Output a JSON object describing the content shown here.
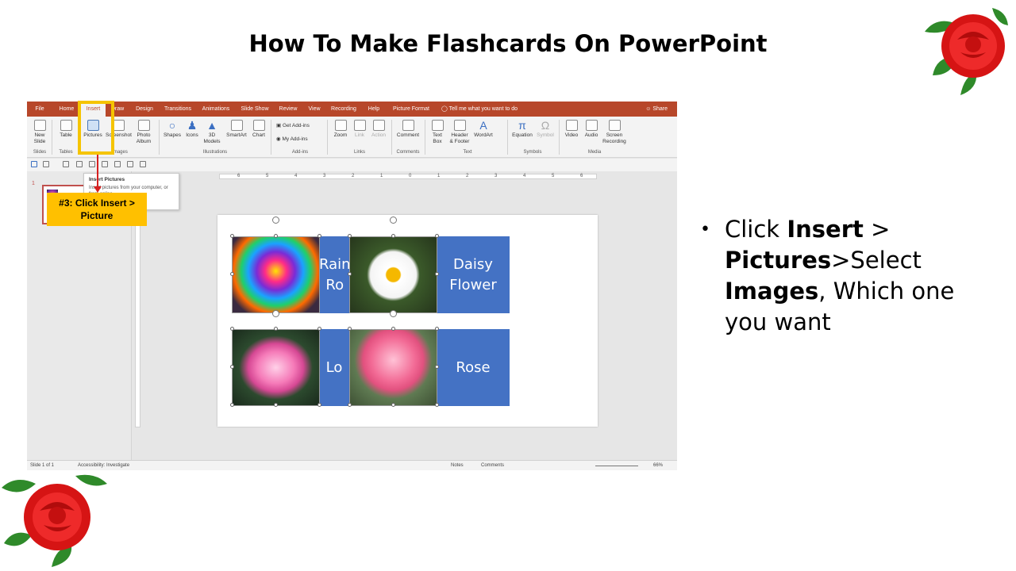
{
  "slide": {
    "title": "How To Make Flashcards On PowerPoint",
    "bullet": {
      "part1": "Click ",
      "bold1": "Insert",
      "part2": "  > ",
      "bold2": "Pictures",
      "part3": ">Select ",
      "bold3": "Images",
      "part4": ", Which one you want"
    },
    "callout": "#3: Click Insert  >\nPicture"
  },
  "ppt": {
    "tabs": [
      "File",
      "Home",
      "Insert",
      "Draw",
      "Design",
      "Transitions",
      "Animations",
      "Slide Show",
      "Review",
      "View",
      "Recording",
      "Help",
      "Picture Format"
    ],
    "active_tab": "Insert",
    "tell_me": "Tell me what you want to do",
    "share": "Share",
    "ribbon": {
      "new_slide": "New\nSlide",
      "table": "Table",
      "pictures": "Pictures",
      "screenshot": "Screenshot",
      "photo_album": "Photo\nAlbum",
      "shapes": "Shapes",
      "icons": "Icons",
      "models_3d": "3D\nModels",
      "smartart": "SmartArt",
      "chart": "Chart",
      "get_addins": "Get Add-ins",
      "my_addins": "My Add-ins",
      "zoom": "Zoom",
      "link": "Link",
      "action": "Action",
      "comment": "Comment",
      "text_box": "Text\nBox",
      "header_footer": "Header\n& Footer",
      "wordart": "WordArt",
      "equation": "Equation",
      "symbol": "Symbol",
      "video": "Video",
      "audio": "Audio",
      "screen_recording": "Screen\nRecording",
      "groups": {
        "slides": "Slides",
        "tables": "Tables",
        "images": "Images",
        "illustrations": "Illustrations",
        "addins": "Add-ins",
        "links": "Links",
        "comments": "Comments",
        "text": "Text",
        "symbols": "Symbols",
        "media": "Media"
      }
    },
    "tooltip": {
      "title": "Insert Pictures",
      "desc": "Insert pictures from your computer, or from online"
    },
    "slide_number": "1",
    "cards": {
      "rainbow_rose": "Rain\nRo",
      "daisy": "Daisy\nFlower",
      "lotus": "Lo",
      "rose": "Rose"
    },
    "statusbar": {
      "slide_of": "Slide 1 of 1",
      "accessibility": "Accessibility: Investigate",
      "notes": "Notes",
      "comments": "Comments",
      "zoom": "66%"
    },
    "ruler_labels": [
      "6",
      "5",
      "4",
      "3",
      "2",
      "1",
      "0",
      "1",
      "2",
      "3",
      "4",
      "5",
      "6"
    ]
  },
  "colors": {
    "ribbon_tab_bar": "#b7472a",
    "card_blue": "#4472c4",
    "callout_yellow": "#ffc000",
    "highlight": "#f5c400",
    "arrow_red": "#d62020"
  }
}
